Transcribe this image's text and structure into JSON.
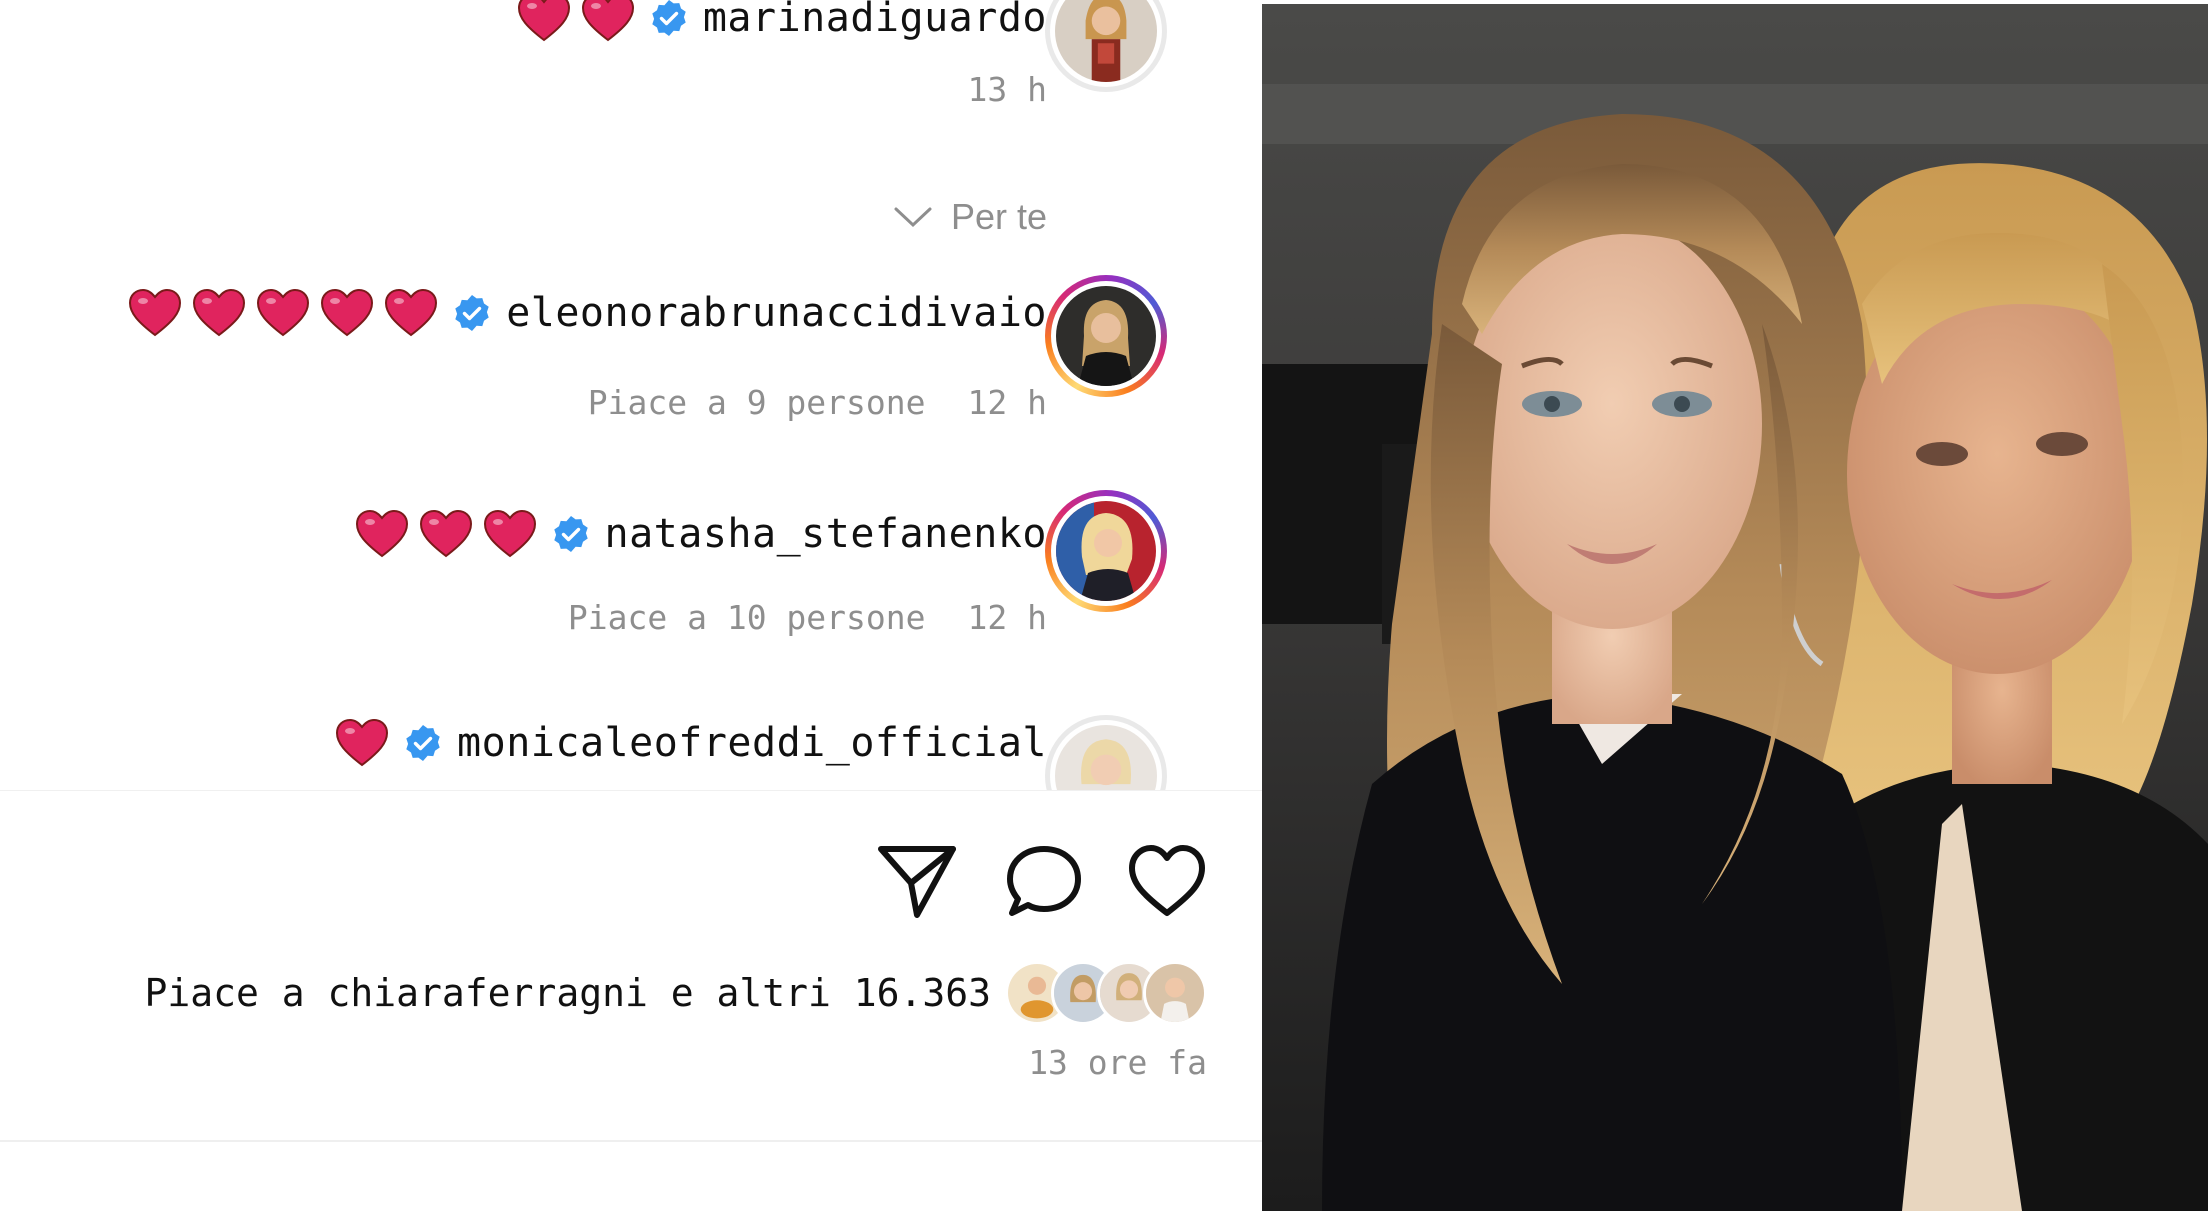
{
  "section": {
    "label": "Per te"
  },
  "comments": [
    {
      "username": "marinadiguardo",
      "verified": true,
      "hearts": 2,
      "time": "13 h",
      "likes": ""
    },
    {
      "username": "eleonorabrunaccidivaio",
      "verified": true,
      "hearts": 5,
      "time": "12 h",
      "likes": "Piace a 9 persone"
    },
    {
      "username": "natasha_stefanenko",
      "verified": true,
      "hearts": 3,
      "time": "12 h",
      "likes": "Piace a 10 persone"
    },
    {
      "username": "monicaleofreddi_official",
      "verified": true,
      "hearts": 1,
      "time": "",
      "likes": ""
    }
  ],
  "actions": {
    "like_icon": "heart-outline-icon",
    "comment_icon": "comment-bubble-icon",
    "share_icon": "paper-plane-icon"
  },
  "post": {
    "likes_text": "Piace a chiaraferragni e altri 16.363",
    "time_ago": "13 ore fa"
  },
  "colors": {
    "heart_red": "#e0245e",
    "verified_blue": "#3897f0",
    "muted_text": "#8e8e8e"
  }
}
